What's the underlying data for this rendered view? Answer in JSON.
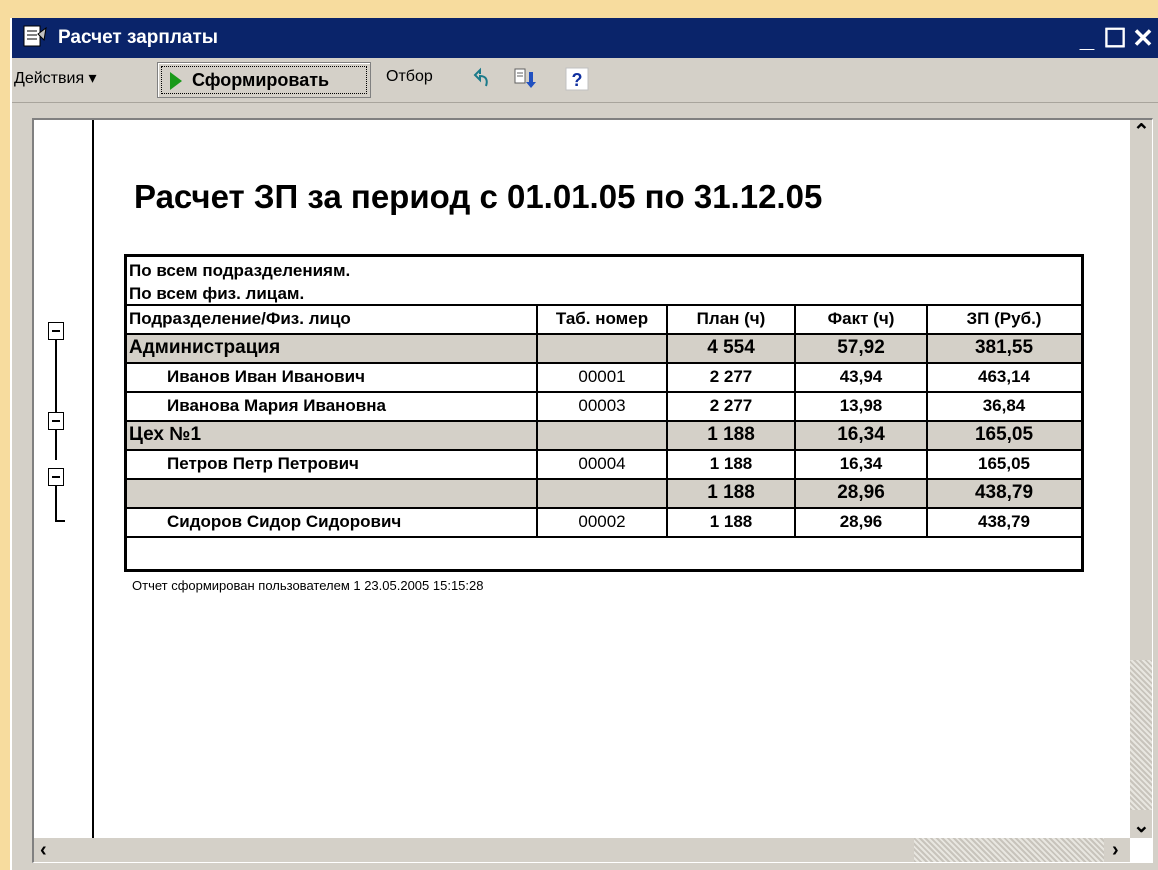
{
  "window": {
    "title": "Расчет зарплаты",
    "minimize": "_",
    "maximize": "☐",
    "close": "✕"
  },
  "toolbar": {
    "actions_label": "Действия ▾",
    "form_label": "Сформировать",
    "filter_label": "Отбор",
    "help_label": "?",
    "icons": [
      "undo-icon",
      "export-icon",
      "help-icon"
    ]
  },
  "report": {
    "title": "Расчет ЗП за период с 01.01.05 по 31.12.05",
    "filter_line1": "По всем подразделениям.",
    "filter_line2": "По всем физ. лицам.",
    "columns": [
      "Подразделение/Физ. лицо",
      "Таб. номер",
      "План (ч)",
      "Факт (ч)",
      "ЗП (Руб.)"
    ],
    "rows": [
      {
        "type": "group",
        "name": "Администрация",
        "tab": "",
        "plan": "4 554",
        "fact": "57,92",
        "zp": "381,55"
      },
      {
        "type": "item",
        "name": "Иванов Иван Иванович",
        "tab": "00001",
        "plan": "2 277",
        "fact": "43,94",
        "zp": "463,14"
      },
      {
        "type": "item",
        "name": "Иванова Мария Ивановна",
        "tab": "00003",
        "plan": "2 277",
        "fact": "13,98",
        "zp": "36,84"
      },
      {
        "type": "group",
        "name": "Цех №1",
        "tab": "",
        "plan": "1 188",
        "fact": "16,34",
        "zp": "165,05"
      },
      {
        "type": "item",
        "name": "Петров Петр Петрович",
        "tab": "00004",
        "plan": "1 188",
        "fact": "16,34",
        "zp": "165,05"
      },
      {
        "type": "group",
        "name": "",
        "tab": "",
        "plan": "1 188",
        "fact": "28,96",
        "zp": "438,79"
      },
      {
        "type": "item",
        "name": "Сидоров Сидор Сидорович",
        "tab": "00002",
        "plan": "1 188",
        "fact": "28,96",
        "zp": "438,79"
      }
    ],
    "footer": "Отчет сформирован пользователем 1 23.05.2005 15:15:28"
  },
  "colors": {
    "desktop": "#f7dc9e",
    "titlebar": "#0a246a",
    "group_row": "#d4d0c8",
    "play_icon": "#1a9a1a"
  }
}
